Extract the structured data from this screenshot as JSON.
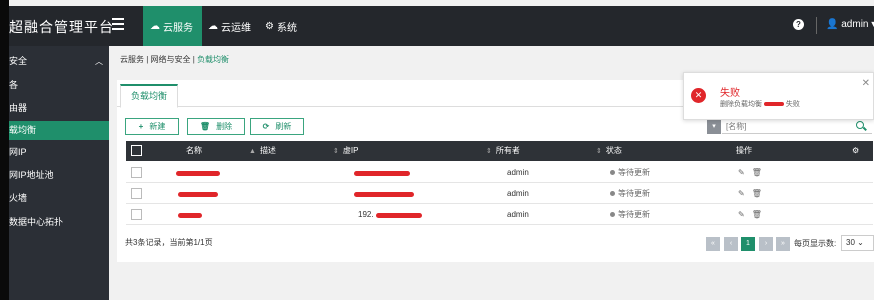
{
  "app": {
    "title": "超融合管理平台"
  },
  "nav": {
    "tabs": [
      {
        "label": "云服务",
        "icon": "cloud-icon",
        "active": true
      },
      {
        "label": "云运维",
        "icon": "cloud-icon",
        "active": false
      },
      {
        "label": "系统",
        "icon": "gear-icon",
        "active": false
      }
    ],
    "help_icon": "question-circle-icon",
    "user": "admin"
  },
  "sidebar": {
    "items": [
      {
        "label": "安全",
        "expandable": true,
        "active": false
      },
      {
        "label": "各",
        "active": false
      },
      {
        "label": "由器",
        "active": false
      },
      {
        "label": "载均衡",
        "active": true
      },
      {
        "label": "网IP",
        "active": false
      },
      {
        "label": "网IP地址池",
        "active": false
      },
      {
        "label": "火墙",
        "active": false
      },
      {
        "label": "数据中心拓扑",
        "active": false
      }
    ]
  },
  "breadcrumb": {
    "parts": [
      "云服务",
      "网络与安全",
      "负载均衡"
    ]
  },
  "main": {
    "tab_label": "负载均衡",
    "buttons": {
      "new": "新建",
      "delete": "删除",
      "refresh": "刷新"
    },
    "search": {
      "placeholder": "[名称]"
    },
    "table": {
      "headers": {
        "name": "名称",
        "desc": "描述",
        "vip": "虚IP",
        "owner": "所有者",
        "status": "状态",
        "ops": "操作"
      },
      "rows": [
        {
          "name": "",
          "desc": "",
          "vip": "",
          "owner": "admin",
          "status": "等待更新"
        },
        {
          "name": "",
          "desc": "",
          "vip": "",
          "owner": "admin",
          "status": "等待更新"
        },
        {
          "name": "",
          "desc": "",
          "vip": "192.",
          "owner": "admin",
          "status": "等待更新"
        }
      ]
    },
    "footer": {
      "summary": "共3条记录，当前第1/1页",
      "current_page": "1",
      "per_page_label": "每页显示数:",
      "per_page_value": "30"
    }
  },
  "toast": {
    "title": "失败",
    "message": "删除负载均衡",
    "suffix": "失败"
  },
  "colors": {
    "accent": "#1f8f6b",
    "topbar": "#24272c",
    "sidebar": "#2b2f36",
    "error": "#e0262a"
  }
}
